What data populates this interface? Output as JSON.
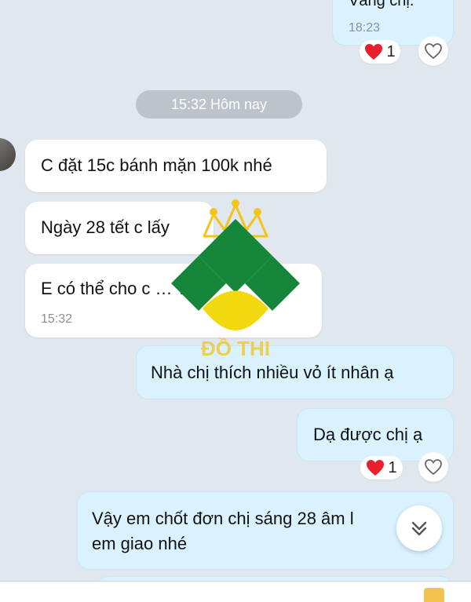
{
  "messages": {
    "top_partial": {
      "text": "Vâng chị.",
      "time": "18:23",
      "reaction_count": "1"
    },
    "date_separator": "15:32 Hôm nay",
    "incoming": [
      {
        "text": "C đặt 15c bánh mặn 100k nhé"
      },
      {
        "text": "Ngày 28 tết c lấy"
      },
      {
        "text": "E có thể cho c … ?",
        "time": "15:32"
      }
    ],
    "outgoing": [
      {
        "text": "Nhà chị thích nhiều vỏ ít nhân ạ"
      },
      {
        "text": "Dạ được chị ạ",
        "reaction_count": "1"
      },
      {
        "text": "Vậy em chốt đơn chị sáng 28 âm l",
        "text2": "em giao nhé"
      }
    ]
  },
  "watermark": {
    "text": "ĐỒ THỊ",
    "colors": {
      "green": "#16873a",
      "yellow": "#f2d90f",
      "gold": "#f3c51a"
    }
  },
  "icons": {
    "heart": "red-heart-icon",
    "like": "heart-outline-icon",
    "scroll": "chevron-double-down-icon"
  },
  "colors": {
    "background": "#e1e7ee",
    "incoming": "#ffffff",
    "outgoing": "#d9f2fe",
    "date_pill": "#bdc3ca"
  }
}
